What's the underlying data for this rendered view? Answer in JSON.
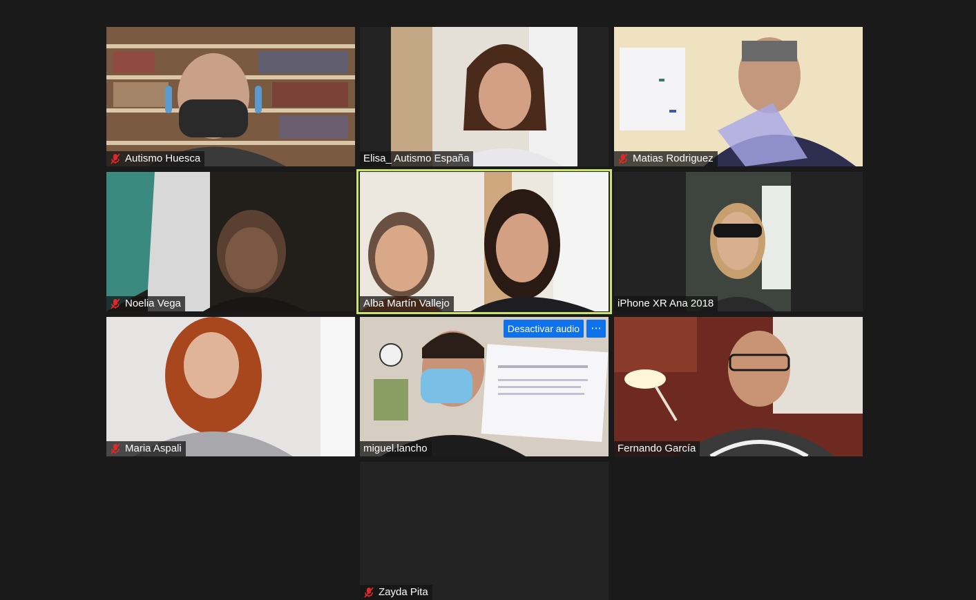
{
  "participants": [
    {
      "name": "Autismo Huesca",
      "muted": true
    },
    {
      "name": "Elisa_ Autismo España",
      "muted": false
    },
    {
      "name": "Matias Rodriguez",
      "muted": true
    },
    {
      "name": "Noelia Vega",
      "muted": true
    },
    {
      "name": "Alba Martín Vallejo",
      "muted": false,
      "active_speaker": true
    },
    {
      "name": "iPhone XR Ana 2018",
      "muted": false
    },
    {
      "name": "Maria Aspali",
      "muted": true
    },
    {
      "name": "miguel.lancho",
      "muted": false
    },
    {
      "name": "Fernando García",
      "muted": false
    },
    {
      "name": "Zayda Pita",
      "muted": true,
      "video_off": true
    }
  ],
  "hover_controls": {
    "unmute_label": "Desactivar audio",
    "more_label": "···"
  },
  "colors": {
    "background": "#1a1a1a",
    "active_speaker_border": "#c9e36b",
    "button_blue": "#0e72ed",
    "muted_red": "#e02828"
  }
}
